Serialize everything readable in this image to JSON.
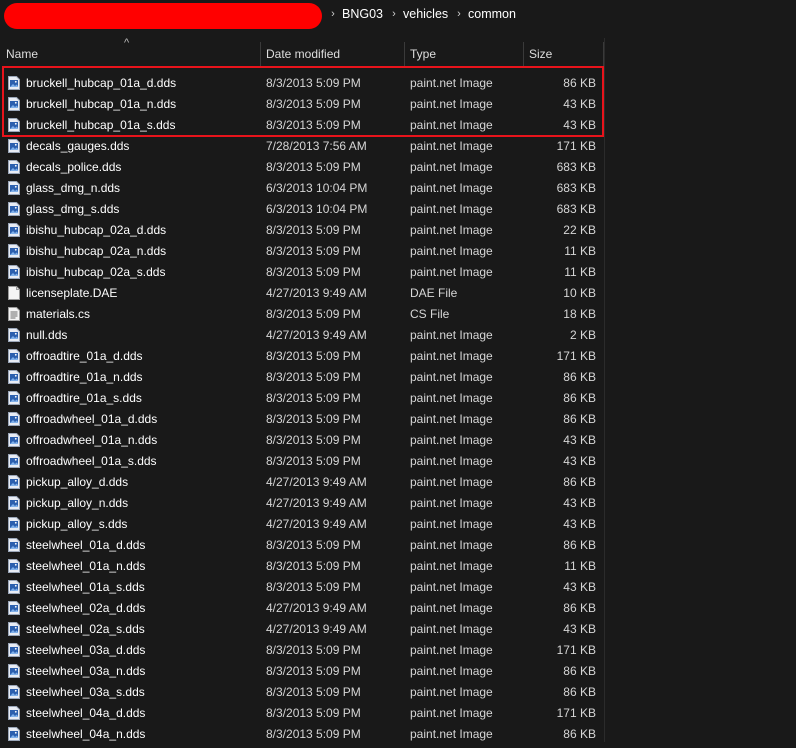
{
  "breadcrumb": [
    "BNG03",
    "vehicles",
    "common"
  ],
  "columns": {
    "name": "Name",
    "date": "Date modified",
    "type": "Type",
    "size": "Size"
  },
  "colors": {
    "highlight": "#e8131b",
    "redaction": "#ff0000",
    "background": "#191919"
  },
  "files": [
    {
      "name": "bruckell_hubcap_01a_d.dds",
      "date": "8/3/2013 5:09 PM",
      "type": "paint.net Image",
      "size": "86 KB",
      "icon": "image-file-icon"
    },
    {
      "name": "bruckell_hubcap_01a_n.dds",
      "date": "8/3/2013 5:09 PM",
      "type": "paint.net Image",
      "size": "43 KB",
      "icon": "image-file-icon"
    },
    {
      "name": "bruckell_hubcap_01a_s.dds",
      "date": "8/3/2013 5:09 PM",
      "type": "paint.net Image",
      "size": "43 KB",
      "icon": "image-file-icon"
    },
    {
      "name": "decals_gauges.dds",
      "date": "7/28/2013 7:56 AM",
      "type": "paint.net Image",
      "size": "171 KB",
      "icon": "image-file-icon"
    },
    {
      "name": "decals_police.dds",
      "date": "8/3/2013 5:09 PM",
      "type": "paint.net Image",
      "size": "683 KB",
      "icon": "image-file-icon"
    },
    {
      "name": "glass_dmg_n.dds",
      "date": "6/3/2013 10:04 PM",
      "type": "paint.net Image",
      "size": "683 KB",
      "icon": "image-file-icon"
    },
    {
      "name": "glass_dmg_s.dds",
      "date": "6/3/2013 10:04 PM",
      "type": "paint.net Image",
      "size": "683 KB",
      "icon": "image-file-icon"
    },
    {
      "name": "ibishu_hubcap_02a_d.dds",
      "date": "8/3/2013 5:09 PM",
      "type": "paint.net Image",
      "size": "22 KB",
      "icon": "image-file-icon"
    },
    {
      "name": "ibishu_hubcap_02a_n.dds",
      "date": "8/3/2013 5:09 PM",
      "type": "paint.net Image",
      "size": "11 KB",
      "icon": "image-file-icon"
    },
    {
      "name": "ibishu_hubcap_02a_s.dds",
      "date": "8/3/2013 5:09 PM",
      "type": "paint.net Image",
      "size": "11 KB",
      "icon": "image-file-icon"
    },
    {
      "name": "licenseplate.DAE",
      "date": "4/27/2013 9:49 AM",
      "type": "DAE File",
      "size": "10 KB",
      "icon": "blank-file-icon"
    },
    {
      "name": "materials.cs",
      "date": "8/3/2013 5:09 PM",
      "type": "CS File",
      "size": "18 KB",
      "icon": "text-file-icon"
    },
    {
      "name": "null.dds",
      "date": "4/27/2013 9:49 AM",
      "type": "paint.net Image",
      "size": "2 KB",
      "icon": "image-file-icon"
    },
    {
      "name": "offroadtire_01a_d.dds",
      "date": "8/3/2013 5:09 PM",
      "type": "paint.net Image",
      "size": "171 KB",
      "icon": "image-file-icon"
    },
    {
      "name": "offroadtire_01a_n.dds",
      "date": "8/3/2013 5:09 PM",
      "type": "paint.net Image",
      "size": "86 KB",
      "icon": "image-file-icon"
    },
    {
      "name": "offroadtire_01a_s.dds",
      "date": "8/3/2013 5:09 PM",
      "type": "paint.net Image",
      "size": "86 KB",
      "icon": "image-file-icon"
    },
    {
      "name": "offroadwheel_01a_d.dds",
      "date": "8/3/2013 5:09 PM",
      "type": "paint.net Image",
      "size": "86 KB",
      "icon": "image-file-icon"
    },
    {
      "name": "offroadwheel_01a_n.dds",
      "date": "8/3/2013 5:09 PM",
      "type": "paint.net Image",
      "size": "43 KB",
      "icon": "image-file-icon"
    },
    {
      "name": "offroadwheel_01a_s.dds",
      "date": "8/3/2013 5:09 PM",
      "type": "paint.net Image",
      "size": "43 KB",
      "icon": "image-file-icon"
    },
    {
      "name": "pickup_alloy_d.dds",
      "date": "4/27/2013 9:49 AM",
      "type": "paint.net Image",
      "size": "86 KB",
      "icon": "image-file-icon"
    },
    {
      "name": "pickup_alloy_n.dds",
      "date": "4/27/2013 9:49 AM",
      "type": "paint.net Image",
      "size": "43 KB",
      "icon": "image-file-icon"
    },
    {
      "name": "pickup_alloy_s.dds",
      "date": "4/27/2013 9:49 AM",
      "type": "paint.net Image",
      "size": "43 KB",
      "icon": "image-file-icon"
    },
    {
      "name": "steelwheel_01a_d.dds",
      "date": "8/3/2013 5:09 PM",
      "type": "paint.net Image",
      "size": "86 KB",
      "icon": "image-file-icon"
    },
    {
      "name": "steelwheel_01a_n.dds",
      "date": "8/3/2013 5:09 PM",
      "type": "paint.net Image",
      "size": "11 KB",
      "icon": "image-file-icon"
    },
    {
      "name": "steelwheel_01a_s.dds",
      "date": "8/3/2013 5:09 PM",
      "type": "paint.net Image",
      "size": "43 KB",
      "icon": "image-file-icon"
    },
    {
      "name": "steelwheel_02a_d.dds",
      "date": "4/27/2013 9:49 AM",
      "type": "paint.net Image",
      "size": "86 KB",
      "icon": "image-file-icon"
    },
    {
      "name": "steelwheel_02a_s.dds",
      "date": "4/27/2013 9:49 AM",
      "type": "paint.net Image",
      "size": "43 KB",
      "icon": "image-file-icon"
    },
    {
      "name": "steelwheel_03a_d.dds",
      "date": "8/3/2013 5:09 PM",
      "type": "paint.net Image",
      "size": "171 KB",
      "icon": "image-file-icon"
    },
    {
      "name": "steelwheel_03a_n.dds",
      "date": "8/3/2013 5:09 PM",
      "type": "paint.net Image",
      "size": "86 KB",
      "icon": "image-file-icon"
    },
    {
      "name": "steelwheel_03a_s.dds",
      "date": "8/3/2013 5:09 PM",
      "type": "paint.net Image",
      "size": "86 KB",
      "icon": "image-file-icon"
    },
    {
      "name": "steelwheel_04a_d.dds",
      "date": "8/3/2013 5:09 PM",
      "type": "paint.net Image",
      "size": "171 KB",
      "icon": "image-file-icon"
    },
    {
      "name": "steelwheel_04a_n.dds",
      "date": "8/3/2013 5:09 PM",
      "type": "paint.net Image",
      "size": "86 KB",
      "icon": "image-file-icon"
    }
  ]
}
